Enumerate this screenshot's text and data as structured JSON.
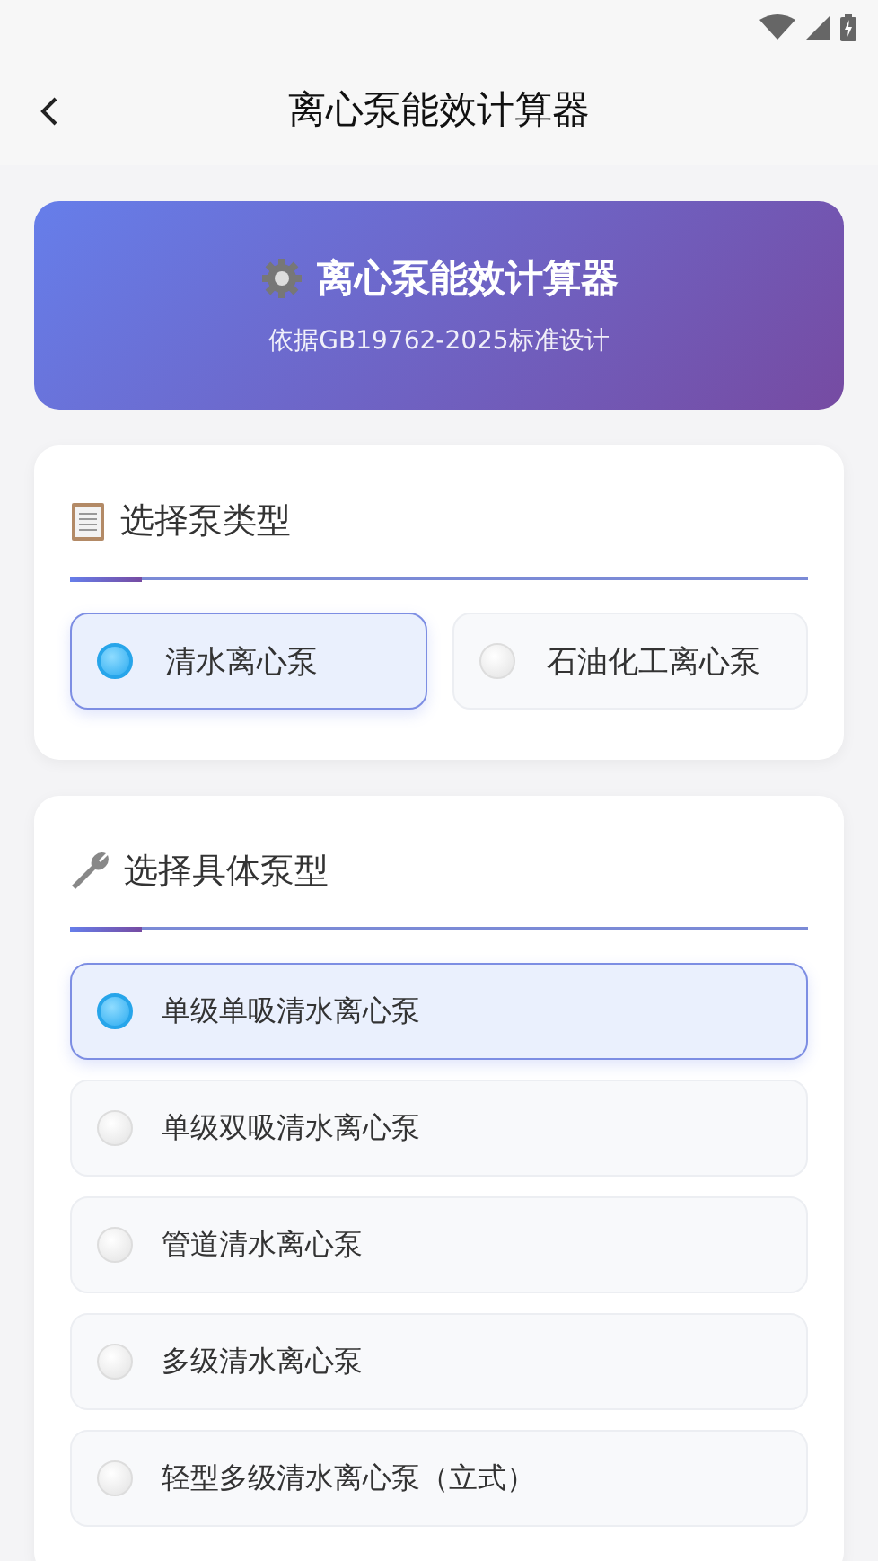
{
  "app_bar": {
    "title": "离心泵能效计算器"
  },
  "hero": {
    "title": "离心泵能效计算器",
    "subtitle": "依据GB19762-2025标准设计"
  },
  "sections": [
    {
      "kind": "grid",
      "title": "选择泵类型",
      "options": [
        {
          "label": "清水离心泵",
          "selected": true
        },
        {
          "label": "石油化工离心泵",
          "selected": false
        }
      ]
    },
    {
      "kind": "list",
      "title": "选择具体泵型",
      "options": [
        {
          "label": "单级单吸清水离心泵",
          "selected": true
        },
        {
          "label": "单级双吸清水离心泵",
          "selected": false
        },
        {
          "label": "管道清水离心泵",
          "selected": false
        },
        {
          "label": "多级清水离心泵",
          "selected": false
        },
        {
          "label": "轻型多级清水离心泵（立式）",
          "selected": false
        }
      ]
    }
  ]
}
